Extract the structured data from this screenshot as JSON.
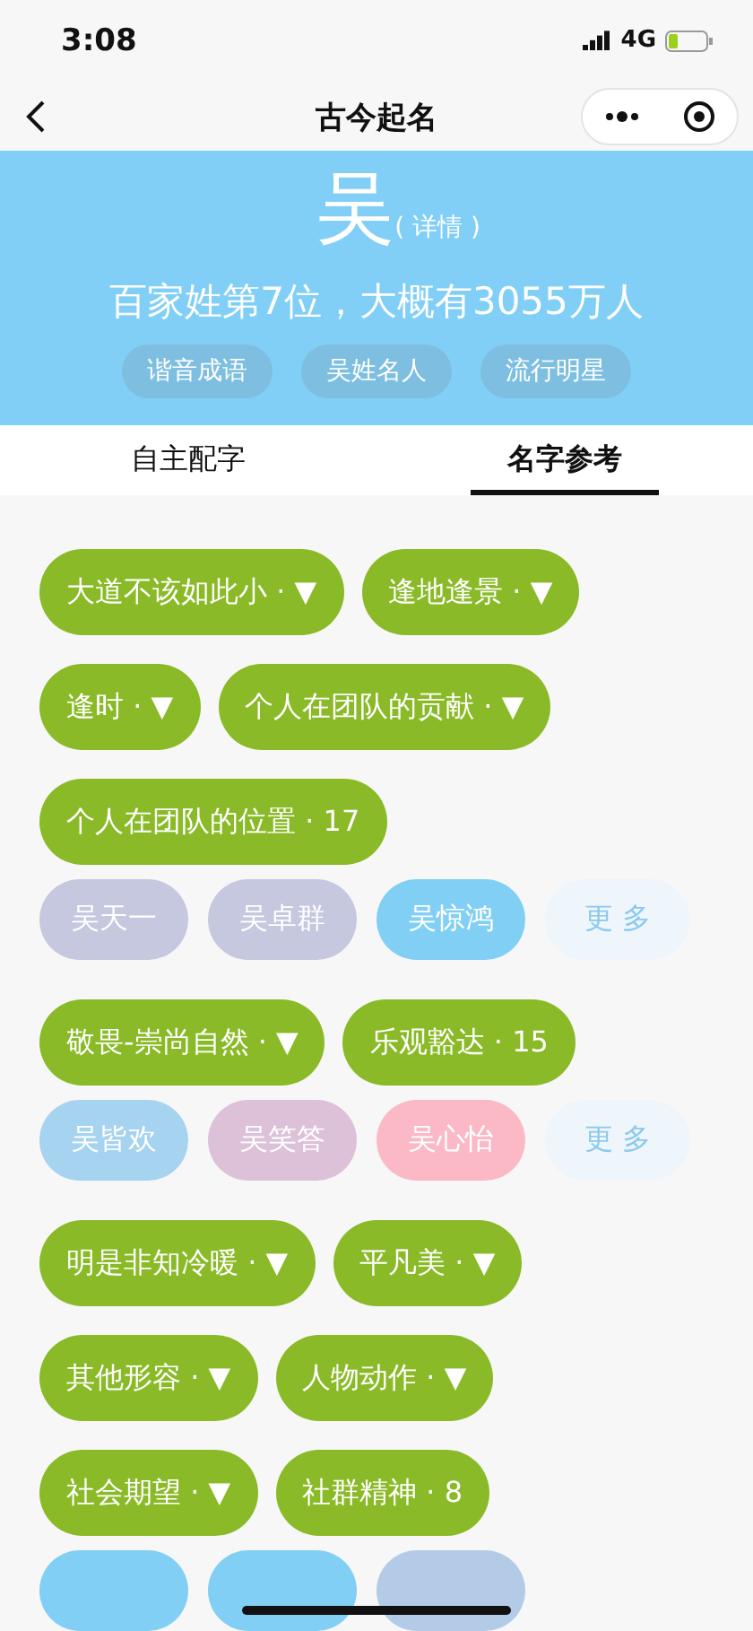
{
  "status_bar": {
    "time": "3:08",
    "network": "4G"
  },
  "nav": {
    "title": "古今起名"
  },
  "banner": {
    "surname": "吴",
    "detail_link": "( 详情 )",
    "summary": "百家姓第7位，大概有3055万人",
    "chips": [
      "谐音成语",
      "吴姓名人",
      "流行明星"
    ]
  },
  "tabs": [
    {
      "label": "自主配字",
      "selected": false
    },
    {
      "label": "名字参考",
      "selected": true
    }
  ],
  "sections": [
    {
      "tags": [
        "大道不该如此小 · ▼",
        "逢地逢景 · ▼",
        "逢时 · ▼",
        "个人在团队的贡献 · ▼",
        "个人在团队的位置 · 17"
      ],
      "names": [
        {
          "text": "吴天一",
          "color": "#c5c8de"
        },
        {
          "text": "吴卓群",
          "color": "#c5c8de"
        },
        {
          "text": "吴惊鸿",
          "color": "#81cff4"
        }
      ],
      "more": "更 多"
    },
    {
      "tags": [
        "敬畏-崇尚自然 · ▼",
        "乐观豁达 · 15"
      ],
      "names": [
        {
          "text": "吴皆欢",
          "color": "#a6d3f0"
        },
        {
          "text": "吴笑答",
          "color": "#dcc1d8"
        },
        {
          "text": "吴心怡",
          "color": "#fbb9c6"
        }
      ],
      "more": "更 多"
    },
    {
      "tags": [
        "明是非知冷暖 · ▼",
        "平凡美 · ▼",
        "其他形容 · ▼",
        "人物动作 · ▼",
        "社会期望 · ▼",
        "社群精神 · 8"
      ],
      "names": [
        {
          "color": "#81cff4"
        },
        {
          "color": "#81cff4"
        },
        {
          "color": "#b3cbe6"
        }
      ]
    }
  ]
}
